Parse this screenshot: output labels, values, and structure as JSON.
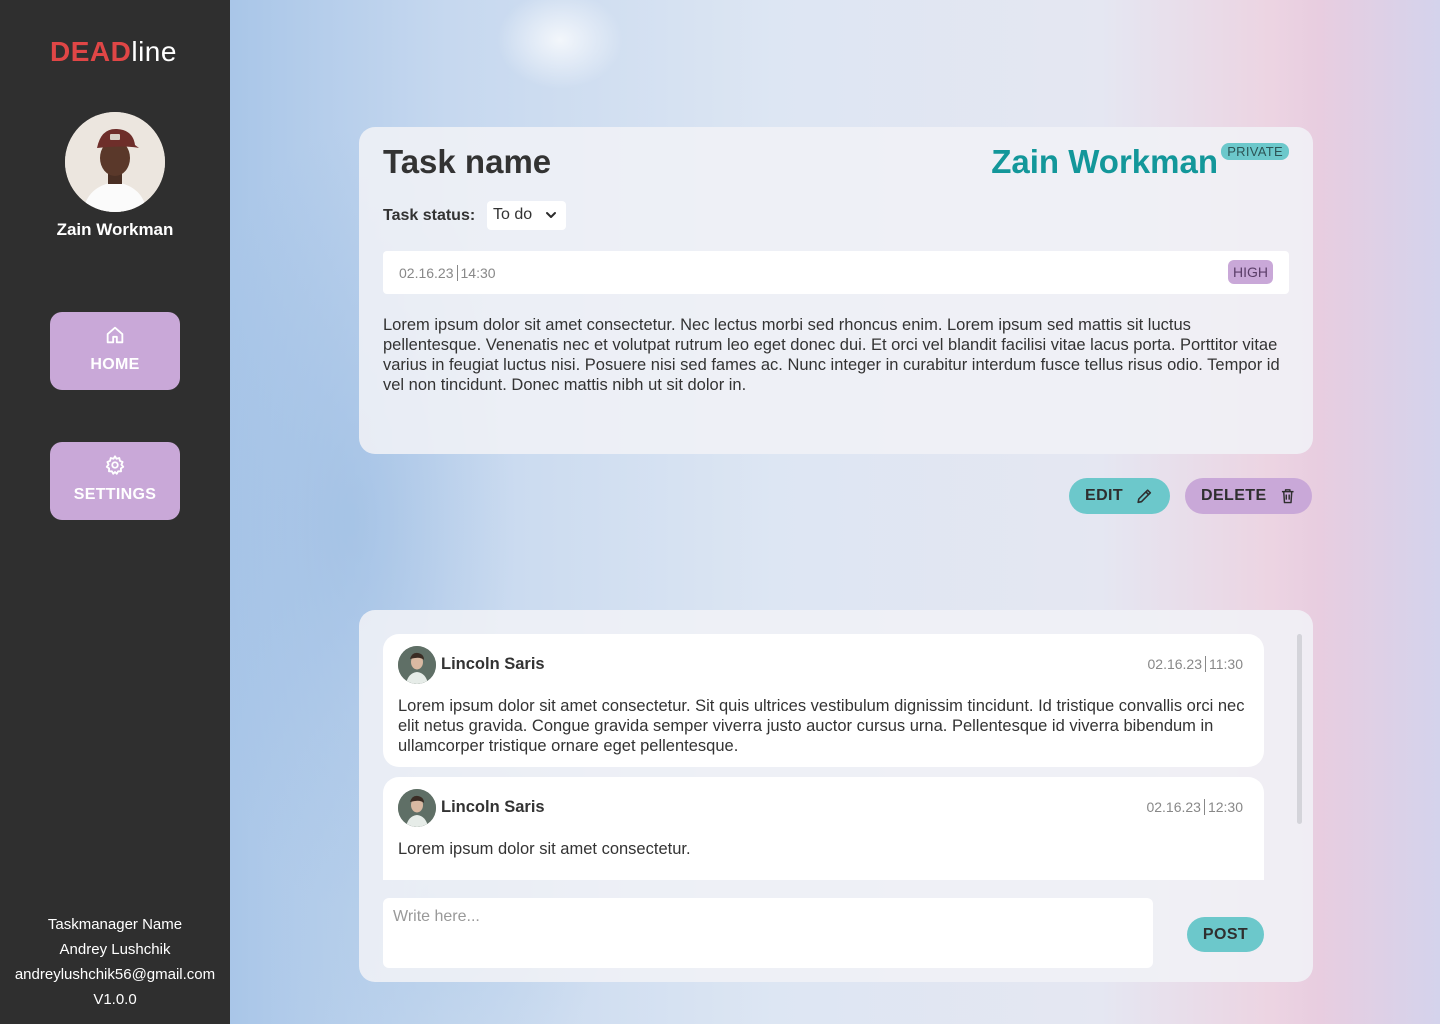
{
  "app": {
    "logo_bold": "DEAD",
    "logo_light": "line"
  },
  "sidebar": {
    "user_name": "Zain Workman",
    "nav": [
      {
        "label": "HOME",
        "icon": "home-icon"
      },
      {
        "label": "SETTINGS",
        "icon": "gear-icon"
      }
    ],
    "footer": {
      "app_name": "Taskmanager Name",
      "author": "Andrey Lushchik",
      "email": "andreylushchik56@gmail.com",
      "version": "V1.0.0"
    }
  },
  "task": {
    "title": "Task name",
    "owner": "Zain Workman",
    "visibility": "PRIVATE",
    "status_label": "Task status:",
    "status_value": "To do",
    "date": "02.16.23",
    "time": "14:30",
    "priority": "HIGH",
    "description": "Lorem ipsum dolor sit amet consectetur. Nec lectus morbi sed rhoncus enim. Lorem ipsum sed mattis sit luctus pellentesque. Venenatis nec et volutpat rutrum leo eget donec dui. Et orci vel blandit facilisi vitae lacus porta. Porttitor vitae varius in feugiat luctus nisi. Posuere nisi sed fames ac. Nunc integer in curabitur interdum fusce tellus risus odio. Tempor id vel non tincidunt. Donec mattis nibh ut sit dolor in."
  },
  "actions": {
    "edit_label": "EDIT",
    "delete_label": "DELETE"
  },
  "comments": [
    {
      "author": "Lincoln Saris",
      "date": "02.16.23",
      "time": "11:30",
      "text": "Lorem ipsum dolor sit amet consectetur. Sit quis ultrices vestibulum dignissim tincidunt. Id tristique convallis orci nec elit netus gravida. Congue gravida semper viverra justo auctor cursus urna. Pellentesque id viverra bibendum in ullamcorper tristique ornare eget pellentesque."
    },
    {
      "author": "Lincoln Saris",
      "date": "02.16.23",
      "time": "12:30",
      "text": "Lorem ipsum dolor sit amet consectetur."
    }
  ],
  "composer": {
    "placeholder": "Write here...",
    "value": "",
    "post_label": "POST"
  },
  "colors": {
    "sidebar_bg": "#2f2f2f",
    "accent_purple": "#c9a8d8",
    "accent_teal": "#6cc8cb",
    "owner_teal": "#13979a",
    "logo_red": "#e04646"
  }
}
